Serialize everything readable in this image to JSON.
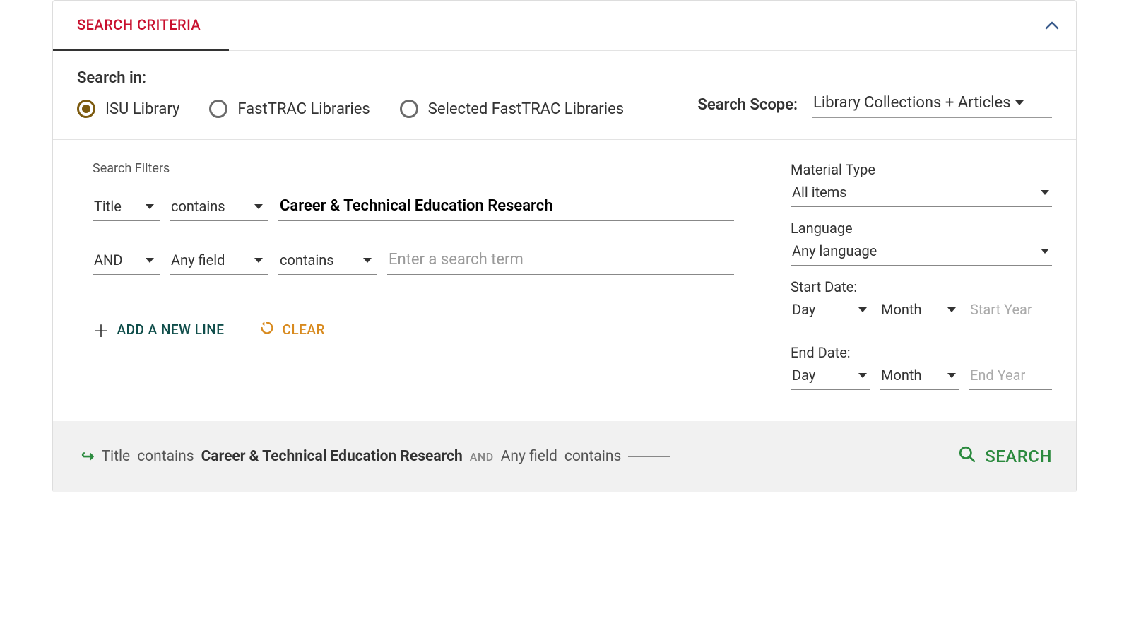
{
  "header": {
    "tab_title": "SEARCH CRITERIA"
  },
  "search_in": {
    "title": "Search in:",
    "options": [
      "ISU Library",
      "FastTRAC Libraries",
      "Selected FastTRAC Libraries"
    ],
    "selected_index": 0,
    "scope_label": "Search Scope:",
    "scope_value": "Library Collections + Articles"
  },
  "filters": {
    "title": "Search Filters",
    "rows": [
      {
        "field": "Title",
        "match": "contains",
        "value": "Career & Technical Education Research",
        "placeholder": ""
      },
      {
        "bool": "AND",
        "field": "Any field",
        "match": "contains",
        "value": "",
        "placeholder": "Enter a search term"
      }
    ],
    "actions": {
      "add": "ADD A NEW LINE",
      "clear": "CLEAR"
    }
  },
  "right": {
    "material_label": "Material Type",
    "material_value": "All items",
    "language_label": "Language",
    "language_value": "Any language",
    "start_label": "Start Date:",
    "end_label": "End Date:",
    "day": "Day",
    "month": "Month",
    "start_year_ph": "Start Year",
    "end_year_ph": "End Year"
  },
  "summary": {
    "field1": "Title",
    "match1": "contains",
    "value1": "Career & Technical Education Research",
    "op": "AND",
    "field2": "Any field",
    "match2": "contains",
    "search_btn": "SEARCH"
  }
}
